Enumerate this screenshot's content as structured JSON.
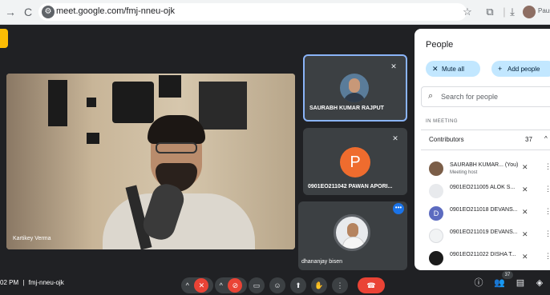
{
  "browser": {
    "back_icon": "→",
    "reload_icon": "C",
    "url": "meet.google.com/fmj-nneu-ojk",
    "profile_label": "Paus"
  },
  "main_video": {
    "name": "Kartikey Verma"
  },
  "tiles": [
    {
      "name": "SAURABH KUMAR RAJPUT"
    },
    {
      "name": "0901EO211042 PAWAN APORI...",
      "initial": "P",
      "avatar_color": "#ef6c2e"
    },
    {
      "name": "dhananjay bisen"
    }
  ],
  "panel": {
    "title": "People",
    "mute_all": "Mute all",
    "add_people": "Add people",
    "search_placeholder": "Search for people",
    "section_label": "IN MEETING",
    "group_label": "Contributors",
    "group_count": "37",
    "participants": [
      {
        "name": "SAURABH KUMAR... (You)",
        "sub": "Meeting host"
      },
      {
        "name": "0901EO211005 ALOK S..."
      },
      {
        "name": "0901EO211018 DEVANS...",
        "initial": "D"
      },
      {
        "name": "0901EO211019 DEVANS..."
      },
      {
        "name": "0901EO211022 DISHA T..."
      }
    ]
  },
  "bottom": {
    "time": "02 PM",
    "separator": "|",
    "meeting_code": "fmj-nneu-ojk",
    "people_count": "37"
  },
  "colors": {
    "accent": "#8ab4f8",
    "danger": "#ea4335",
    "pill": "#c2e7ff",
    "warning": "#fbbc04"
  }
}
